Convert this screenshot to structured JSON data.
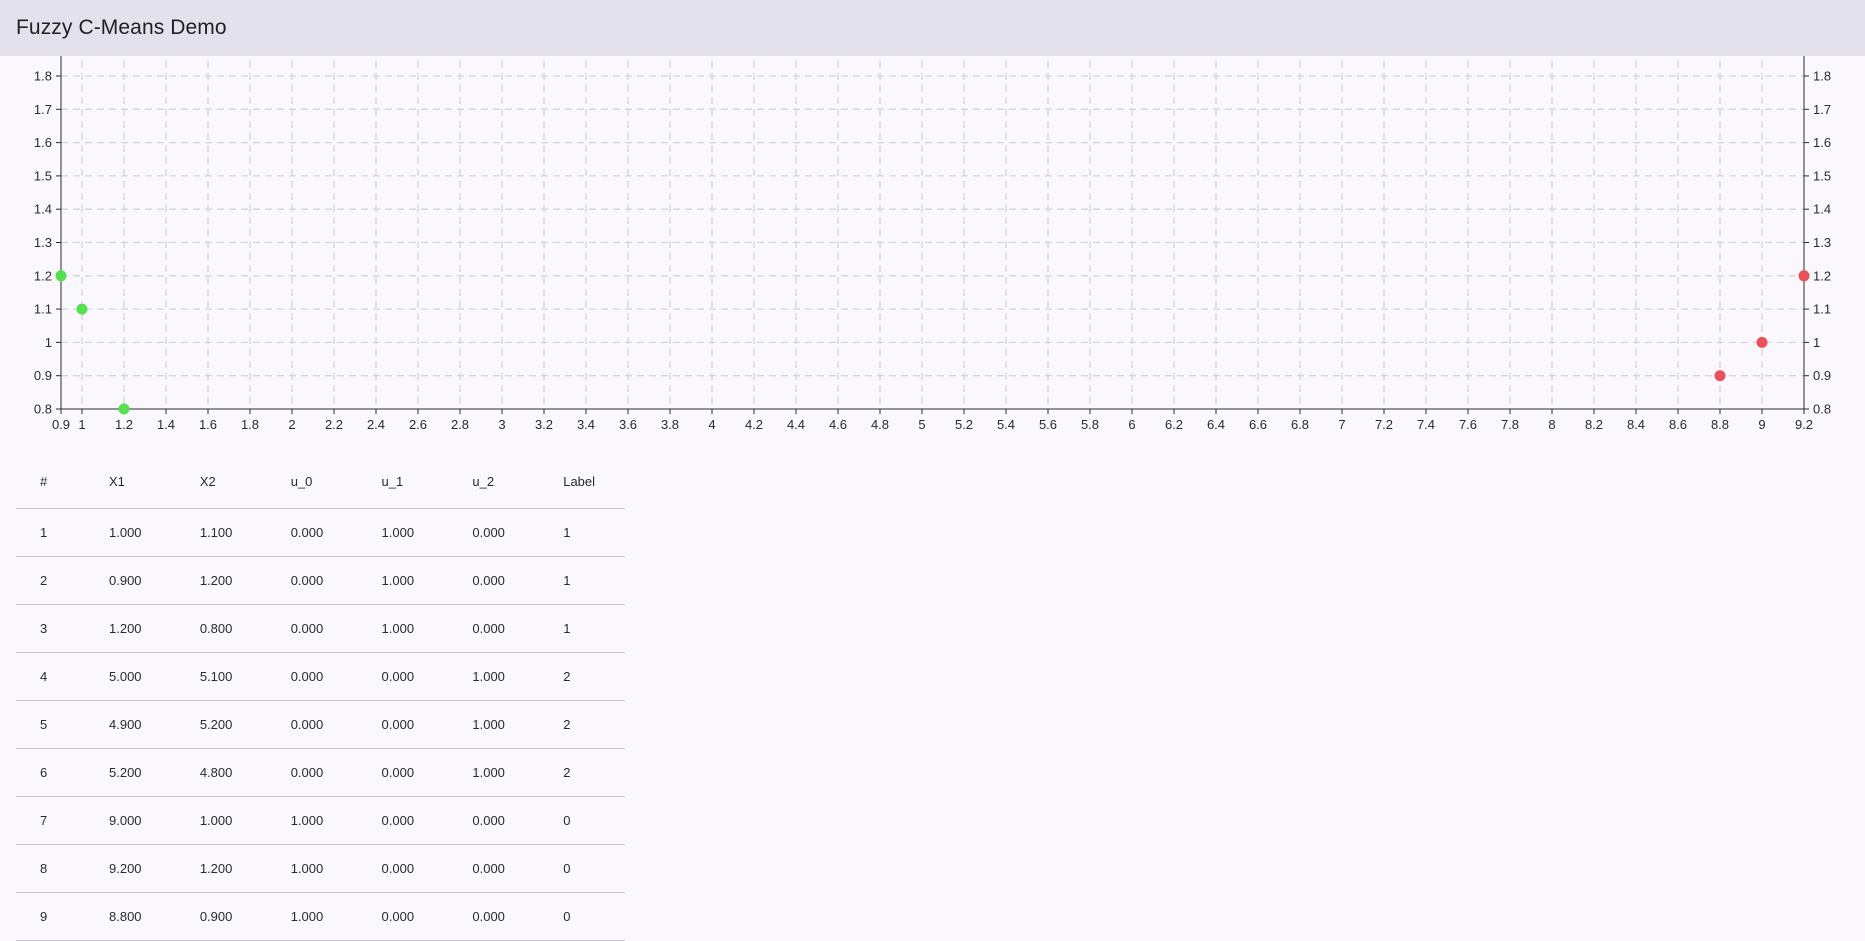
{
  "app": {
    "title": "Fuzzy C-Means Demo"
  },
  "colors": {
    "cluster_0": "#e8515b",
    "cluster_1": "#55e14f",
    "cluster_2": "#5b7fe8",
    "grid": "#d3d3dd",
    "axis": "#2a2a2e"
  },
  "chart_data": {
    "type": "scatter",
    "title": "",
    "xlabel": "",
    "ylabel": "",
    "xlim": [
      0.9,
      9.2
    ],
    "ylim": [
      0.8,
      1.8
    ],
    "x_ticks": [
      "0.9",
      "1",
      "1.2",
      "1.4",
      "1.6",
      "1.8",
      "2",
      "2.2",
      "2.4",
      "2.6",
      "2.8",
      "3",
      "3.2",
      "3.4",
      "3.6",
      "3.8",
      "4",
      "4.2",
      "4.4",
      "4.6",
      "4.8",
      "5",
      "5.2",
      "5.4",
      "5.6",
      "5.8",
      "6",
      "6.2",
      "6.4",
      "6.6",
      "6.8",
      "7",
      "7.2",
      "7.4",
      "7.6",
      "7.8",
      "8",
      "8.2",
      "8.4",
      "8.6",
      "8.8",
      "9",
      "9.2"
    ],
    "y_ticks": [
      "0.8",
      "0.9",
      "1",
      "1.1",
      "1.2",
      "1.3",
      "1.4",
      "1.5",
      "1.6",
      "1.7",
      "1.8"
    ],
    "grid": true,
    "series": [
      {
        "x": [
          1.0,
          0.9,
          1.2
        ],
        "y": [
          1.1,
          1.2,
          0.8
        ],
        "color": "#55e14f"
      },
      {
        "x": [
          9.0,
          9.2,
          8.8
        ],
        "y": [
          1.0,
          1.2,
          0.9
        ],
        "color": "#e8515b"
      }
    ]
  },
  "table": {
    "columns": [
      "#",
      "X1",
      "X2",
      "u_0",
      "u_1",
      "u_2",
      "Label"
    ],
    "rows": [
      [
        "1",
        "1.000",
        "1.100",
        "0.000",
        "1.000",
        "0.000",
        "1"
      ],
      [
        "2",
        "0.900",
        "1.200",
        "0.000",
        "1.000",
        "0.000",
        "1"
      ],
      [
        "3",
        "1.200",
        "0.800",
        "0.000",
        "1.000",
        "0.000",
        "1"
      ],
      [
        "4",
        "5.000",
        "5.100",
        "0.000",
        "0.000",
        "1.000",
        "2"
      ],
      [
        "5",
        "4.900",
        "5.200",
        "0.000",
        "0.000",
        "1.000",
        "2"
      ],
      [
        "6",
        "5.200",
        "4.800",
        "0.000",
        "0.000",
        "1.000",
        "2"
      ],
      [
        "7",
        "9.000",
        "1.000",
        "1.000",
        "0.000",
        "0.000",
        "0"
      ],
      [
        "8",
        "9.200",
        "1.200",
        "1.000",
        "0.000",
        "0.000",
        "0"
      ],
      [
        "9",
        "8.800",
        "0.900",
        "1.000",
        "0.000",
        "0.000",
        "0"
      ]
    ]
  }
}
